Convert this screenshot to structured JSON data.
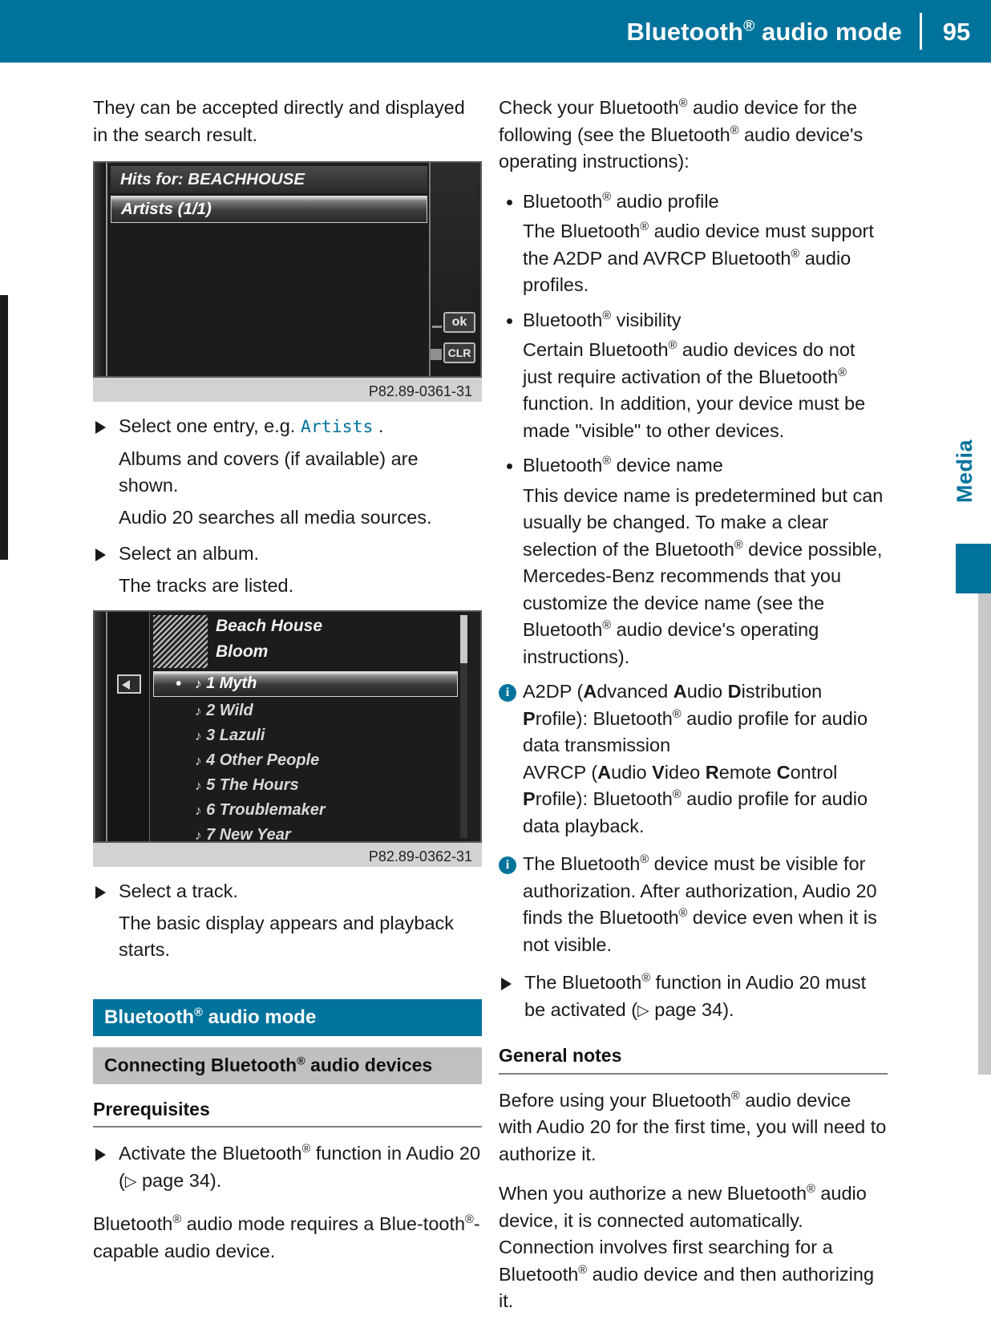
{
  "header": {
    "title_prefix": "Bluetooth",
    "title_suffix": " audio mode",
    "page_number": "95",
    "bg_color": "#00739c"
  },
  "edge_tab": {
    "label": "Media",
    "color": "#00739c"
  },
  "left_column": {
    "intro": "They can be accepted directly and displayed in the search result.",
    "figure1": {
      "title_bar": "Hits for: BEACHHOUSE",
      "selected_row": "Artists (1/1)",
      "key_ok": "ok",
      "key_clr": "CLR",
      "caption": "P82.89-0361-31"
    },
    "step1": {
      "text_before": "Select one entry, e.g. ",
      "ui_ref": "Artists",
      "text_after": " ."
    },
    "step1_detail": "Albums and covers (if available) are shown.",
    "step1_detail2": "Audio 20 searches all media sources.",
    "step2": "Select an album.",
    "step2_detail": "The tracks are listed.",
    "figure2": {
      "artist": "Beach House",
      "album": "Bloom",
      "tracks": [
        "1 Myth",
        "2 Wild",
        "3 Lazuli",
        "4 Other People",
        "5 The Hours",
        "6 Troublemaker",
        "7 New Year"
      ],
      "caption": "P82.89-0362-31"
    },
    "step3": "Select a track.",
    "step3_detail": "The basic display appears and playback starts.",
    "section_heading_prefix": "Bluetooth",
    "section_heading_suffix": " audio mode",
    "subsection_heading_prefix": "Connecting Bluetooth",
    "subsection_heading_suffix": " audio devices",
    "prerequisites_heading": "Prerequisites",
    "prereq_step_a": "Activate the Bluetooth",
    "prereq_step_b": " function in Audio 20 (",
    "prereq_step_pageref": " page 34).",
    "closing_a": "Bluetooth",
    "closing_b": " audio mode requires a Blue-tooth",
    "closing_c": "-capable audio device."
  },
  "right_column": {
    "intro_a": "Check your Bluetooth",
    "intro_b": " audio device for the following (see the Bluetooth",
    "intro_c": " audio device's operating instructions):",
    "bullets": [
      {
        "title_a": "Bluetooth",
        "title_b": " audio profile",
        "body_a": "The Bluetooth",
        "body_b": " audio device must support the A2DP and AVRCP Bluetooth",
        "body_c": " audio profiles."
      },
      {
        "title_a": "Bluetooth",
        "title_b": " visibility",
        "body_a": "Certain Bluetooth",
        "body_b": " audio devices do not just require activation of the Bluetooth",
        "body_c": " function. In addition, your device must be made \"visible\" to other devices."
      },
      {
        "title_a": "Bluetooth",
        "title_b": " device name",
        "body_a": "This device name is predetermined but can usually be changed. To make a clear selection of the Bluetooth",
        "body_b": " device possible, Mercedes-Benz recommends that you customize the device name (see the Bluetooth",
        "body_c": " audio device's operating instructions)."
      }
    ],
    "note1": {
      "a2dp_acronym": "A2DP (",
      "a2dp_A1": "A",
      "a2dp_w1": "dvanced ",
      "a2dp_A2": "A",
      "a2dp_w2": "udio ",
      "a2dp_D": "D",
      "a2dp_w3": "istribution ",
      "a2dp_P": "P",
      "a2dp_w4": "rofile): Bluetooth",
      "a2dp_tail": " audio profile for audio data transmission",
      "avrcp_acronym": "AVRCP (",
      "avrcp_A": "A",
      "avrcp_w1": "udio ",
      "avrcp_V": "V",
      "avrcp_w2": "ideo ",
      "avrcp_R": "R",
      "avrcp_w3": "emote ",
      "avrcp_C": "C",
      "avrcp_w4": "ontrol ",
      "avrcp_P": "P",
      "avrcp_w5": "rofile): Bluetooth",
      "avrcp_tail": " audio profile for audio data playback."
    },
    "note2": {
      "a": "The Bluetooth",
      "b": " device must be visible for authorization. After authorization, Audio 20 finds the Bluetooth",
      "c": " device even when it is not visible."
    },
    "step_bt": {
      "a": "The Bluetooth",
      "b": " function in Audio 20 must be activated (",
      "c": " page 34)."
    },
    "general_notes_heading": "General notes",
    "gn_para1_a": "Before using your Bluetooth",
    "gn_para1_b": " audio device with Audio 20 for the first time, you will need to authorize it.",
    "gn_para2_a": "When you authorize a new Bluetooth",
    "gn_para2_b": " audio device, it is connected automatically. Connection involves first searching for a Bluetooth",
    "gn_para2_c": " audio device and then authorizing it."
  }
}
